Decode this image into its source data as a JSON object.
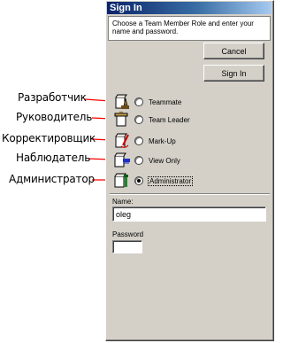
{
  "dialog": {
    "title": "Sign In",
    "instructions": "Choose a Team Member Role and enter your name and password.",
    "cancel_label": "Cancel",
    "signin_label": "Sign In"
  },
  "roles": [
    {
      "label": "Teammate",
      "icon": "teammate-icon",
      "selected": false
    },
    {
      "label": "Team Leader",
      "icon": "team-leader-icon",
      "selected": false
    },
    {
      "label": "Mark-Up",
      "icon": "markup-icon",
      "selected": false
    },
    {
      "label": "View Only",
      "icon": "view-only-icon",
      "selected": false
    },
    {
      "label": "Administrator",
      "icon": "administrator-icon",
      "selected": true
    }
  ],
  "form": {
    "name_label": "Name:",
    "name_value": "oleg",
    "password_label": "Password",
    "password_value": ""
  },
  "callouts": [
    "Разработчик",
    "Руководитель",
    "Корректировщик",
    "Наблюдатель",
    "Администратор"
  ],
  "colors": {
    "panel": "#d4d0c8",
    "titlebar_start": "#0a246a",
    "titlebar_end": "#a6caf0",
    "arrow": "#ff0000"
  }
}
